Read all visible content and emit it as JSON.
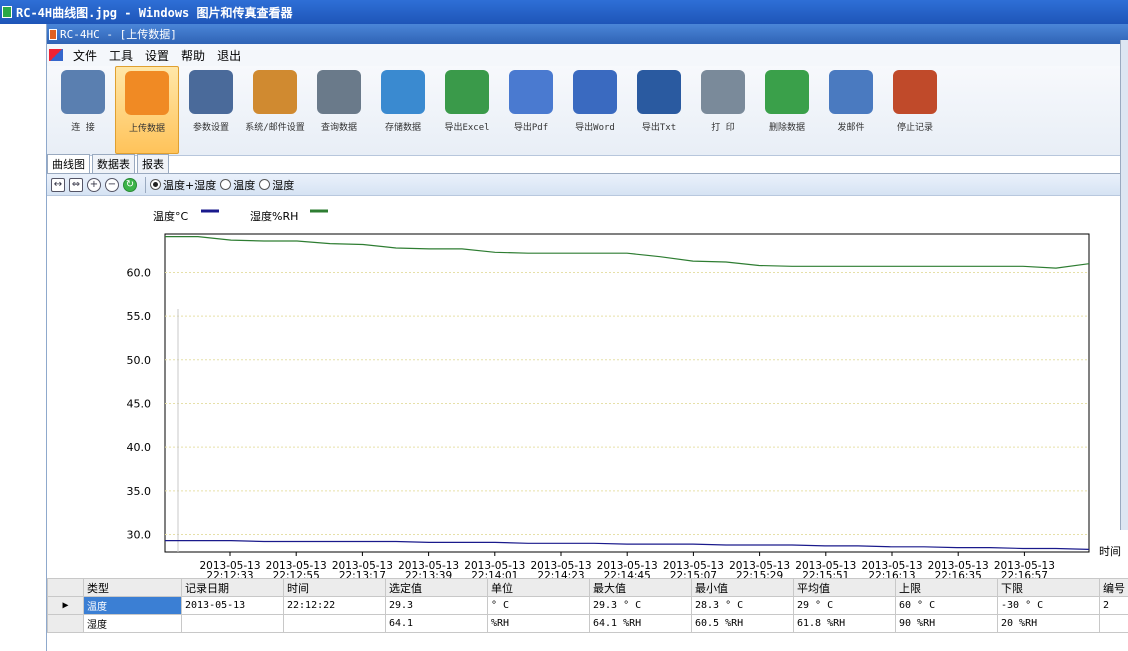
{
  "viewer": {
    "title": "RC-4H曲线图.jpg - Windows 图片和传真查看器"
  },
  "app": {
    "title": "RC-4HC - [上传数据]"
  },
  "menu": [
    "文件",
    "工具",
    "设置",
    "帮助",
    "退出"
  ],
  "toolbar": [
    {
      "label": "连  接",
      "icon": "connect-icon",
      "color": "#5a7fb0"
    },
    {
      "label": "上传数据",
      "icon": "upload-icon",
      "color": "#f08a24",
      "active": true
    },
    {
      "label": "参数设置",
      "icon": "gear-icon",
      "color": "#4a6a9a"
    },
    {
      "label": "系统/邮件设置",
      "icon": "system-settings-icon",
      "color": "#d08a30"
    },
    {
      "label": "查询数据",
      "icon": "search-data-icon",
      "color": "#6a7a8a"
    },
    {
      "label": "存储数据",
      "icon": "save-data-icon",
      "color": "#3a8ad0"
    },
    {
      "label": "导出Excel",
      "icon": "excel-icon",
      "color": "#3a9a4a"
    },
    {
      "label": "导出Pdf",
      "icon": "pdf-icon",
      "color": "#4a7ad0"
    },
    {
      "label": "导出Word",
      "icon": "word-icon",
      "color": "#3a6ac0"
    },
    {
      "label": "导出Txt",
      "icon": "txt-icon",
      "color": "#2a5aa0"
    },
    {
      "label": "打  印",
      "icon": "printer-icon",
      "color": "#7a8a9a"
    },
    {
      "label": "删除数据",
      "icon": "recycle-bin-icon",
      "color": "#3aa04a"
    },
    {
      "label": "发邮件",
      "icon": "mail-icon",
      "color": "#4a7ac0"
    },
    {
      "label": "停止记录",
      "icon": "stop-record-icon",
      "color": "#c04a2a"
    }
  ],
  "tabs": [
    "曲线图",
    "数据表",
    "报表"
  ],
  "chart_toolbar": {
    "radios": [
      {
        "label": "温度+湿度",
        "checked": true
      },
      {
        "label": "温度",
        "checked": false
      },
      {
        "label": "湿度",
        "checked": false
      }
    ]
  },
  "chart_data": {
    "type": "line",
    "legend": [
      {
        "name": "温度°C",
        "color": "#1a1a8c"
      },
      {
        "name": "湿度%RH",
        "color": "#2e7d32"
      }
    ],
    "ylim": [
      28,
      64.4
    ],
    "yticks": [
      "30.0",
      "35.0",
      "40.0",
      "45.0",
      "50.0",
      "55.0",
      "60.0"
    ],
    "yvals": [
      30,
      35,
      40,
      45,
      50,
      55,
      60
    ],
    "xlabel": "时间",
    "xticks": [
      {
        "d": "2013-05-13",
        "t": "22:12:33"
      },
      {
        "d": "2013-05-13",
        "t": "22:12:55"
      },
      {
        "d": "2013-05-13",
        "t": "22:13:17"
      },
      {
        "d": "2013-05-13",
        "t": "22:13:39"
      },
      {
        "d": "2013-05-13",
        "t": "22:14:01"
      },
      {
        "d": "2013-05-13",
        "t": "22:14:23"
      },
      {
        "d": "2013-05-13",
        "t": "22:14:45"
      },
      {
        "d": "2013-05-13",
        "t": "22:15:07"
      },
      {
        "d": "2013-05-13",
        "t": "22:15:29"
      },
      {
        "d": "2013-05-13",
        "t": "22:15:51"
      },
      {
        "d": "2013-05-13",
        "t": "22:16:13"
      },
      {
        "d": "2013-05-13",
        "t": "22:16:35"
      },
      {
        "d": "2013-05-13",
        "t": "22:16:57"
      }
    ],
    "series": [
      {
        "name": "温度°C",
        "color": "#1a1a8c",
        "values": [
          29.3,
          29.3,
          29.3,
          29.2,
          29.2,
          29.2,
          29.2,
          29.2,
          29.1,
          29.1,
          29.1,
          29.0,
          29.0,
          29.0,
          28.9,
          28.9,
          28.9,
          28.8,
          28.8,
          28.8,
          28.7,
          28.7,
          28.6,
          28.6,
          28.5,
          28.5,
          28.4,
          28.4,
          28.3
        ]
      },
      {
        "name": "湿度%RH",
        "color": "#2e7d32",
        "values": [
          64.1,
          64.1,
          63.7,
          63.6,
          63.6,
          63.3,
          63.2,
          62.8,
          62.7,
          62.7,
          62.3,
          62.2,
          62.2,
          62.2,
          62.2,
          61.8,
          61.3,
          61.2,
          60.8,
          60.7,
          60.7,
          60.7,
          60.7,
          60.7,
          60.7,
          60.7,
          60.7,
          60.5,
          61.0
        ]
      }
    ]
  },
  "grid": {
    "headers": [
      "类型",
      "记录日期",
      "时间",
      "选定值",
      "单位",
      "最大值",
      "最小值",
      "平均值",
      "上限",
      "下限",
      "编号"
    ],
    "rows": [
      [
        "温度",
        "2013-05-13",
        "22:12:22",
        "29.3",
        "° C",
        "29.3 ° C",
        "28.3 ° C",
        "29 ° C",
        "60 ° C",
        "-30 ° C",
        "2"
      ],
      [
        "湿度",
        "",
        "",
        "64.1",
        "%RH",
        "64.1 %RH",
        "60.5 %RH",
        "61.8 %RH",
        "90 %RH",
        "20 %RH",
        ""
      ]
    ]
  }
}
